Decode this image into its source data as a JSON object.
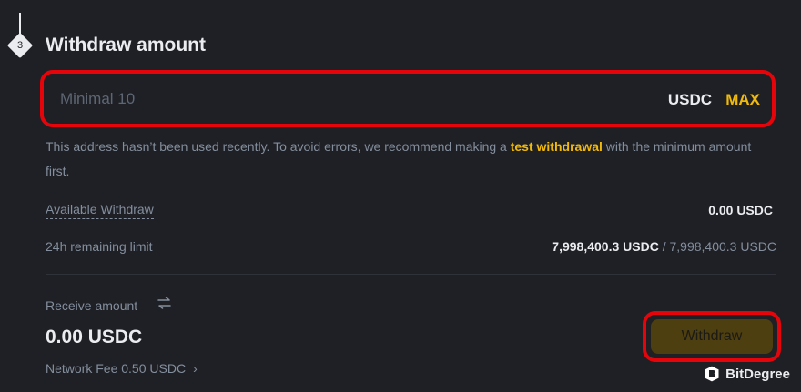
{
  "step": {
    "number": "3",
    "title": "Withdraw amount"
  },
  "amount_input": {
    "value": "",
    "placeholder": "Minimal 10",
    "unit": "USDC",
    "max_label": "MAX"
  },
  "notice": {
    "text_before": "This address hasn’t been used recently. To avoid errors, we recommend making a ",
    "link_text": "test withdrawal",
    "text_after": " with the minimum amount first."
  },
  "available": {
    "label": "Available Withdraw",
    "value": "0.00 USDC"
  },
  "limit": {
    "label": "24h remaining limit",
    "remaining": "7,998,400.3 USDC",
    "total": " / 7,998,400.3 USDC"
  },
  "receive": {
    "label": "Receive amount",
    "amount": "0.00 USDC",
    "fee": "Network Fee 0.50 USDC"
  },
  "withdraw_button": {
    "label": "Withdraw"
  },
  "watermark": {
    "text": "BitDegree"
  },
  "colors": {
    "background": "#1e2026",
    "accent": "#f0b90b",
    "highlight": "#e5040a",
    "muted_text": "#848e9c",
    "primary_text": "#eaecef"
  },
  "icons": {
    "step_badge": "diamond-step-icon",
    "swap": "swap-arrows-icon",
    "fee_chevron": "chevron-right-icon",
    "watermark_logo": "bitdegree-logo-icon"
  }
}
